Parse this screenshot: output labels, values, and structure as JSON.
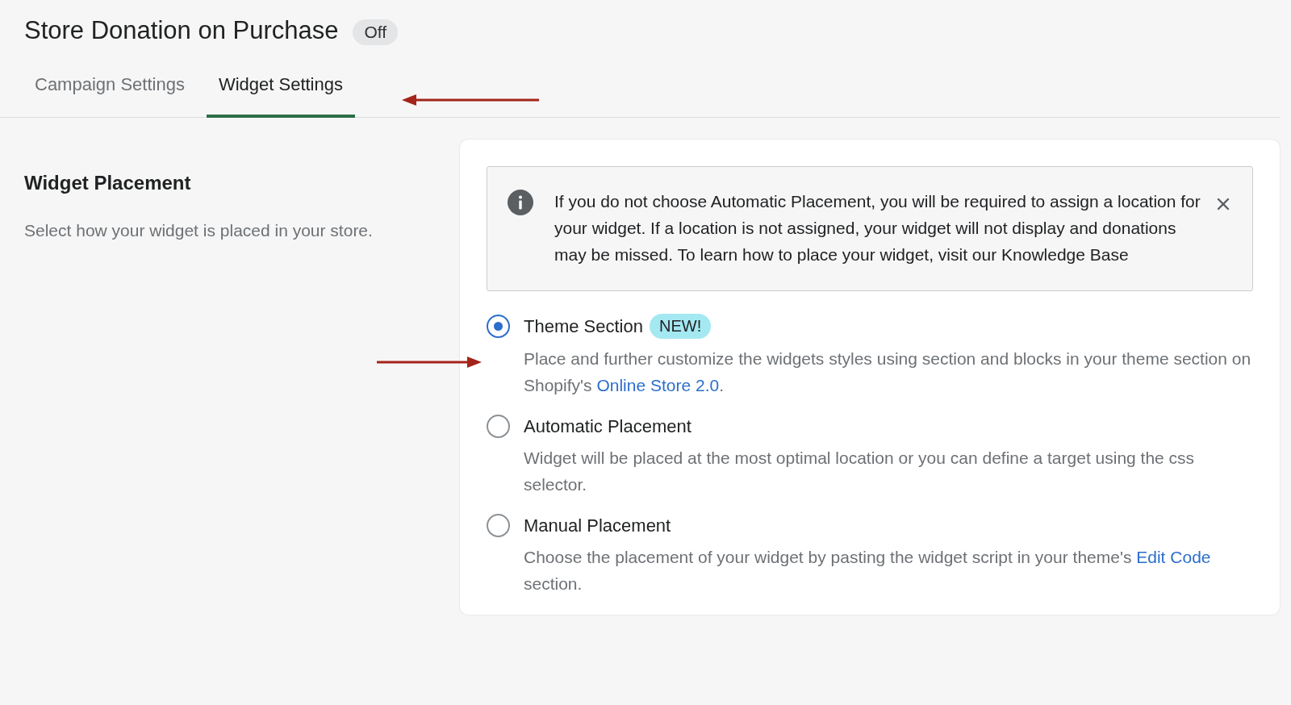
{
  "header": {
    "title": "Store Donation on Purchase",
    "status": "Off"
  },
  "tabs": [
    {
      "label": "Campaign Settings",
      "selected": false
    },
    {
      "label": "Widget Settings",
      "selected": true
    }
  ],
  "section": {
    "title": "Widget Placement",
    "description": "Select how your widget is placed in your store."
  },
  "notice": {
    "text": "If you do not choose Automatic Placement, you will be required to assign a location for your widget. If a location is not assigned, your widget will not display and donations may be missed. To learn how to place your widget, visit our Knowledge Base"
  },
  "options": [
    {
      "label": "Theme Section",
      "badge": "NEW!",
      "selected": true,
      "description": [
        {
          "kind": "text",
          "text": "Place and further customize the widgets styles using section and blocks in your theme section on Shopify's "
        },
        {
          "kind": "link",
          "text": "Online Store 2.0"
        },
        {
          "kind": "text",
          "text": "."
        }
      ]
    },
    {
      "label": "Automatic Placement",
      "selected": false,
      "description": [
        {
          "kind": "text",
          "text": "Widget will be placed at the most optimal location or you can define a target using the css selector."
        }
      ]
    },
    {
      "label": "Manual Placement",
      "selected": false,
      "description": [
        {
          "kind": "text",
          "text": "Choose the placement of your widget by pasting the widget script in your theme's "
        },
        {
          "kind": "link",
          "text": "Edit Code"
        },
        {
          "kind": "text",
          "text": " section."
        }
      ]
    }
  ]
}
